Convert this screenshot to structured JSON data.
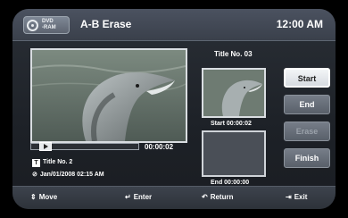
{
  "header": {
    "disc_label": "DVD\n-RAM",
    "title": "A-B Erase",
    "clock": "12:00 AM"
  },
  "preview": {
    "title_no": "Title No. 03",
    "start_label": "Start 00:00:02",
    "end_label": "End 00:00:00"
  },
  "playback": {
    "time": "00:00:02",
    "progress_fraction": 0.08
  },
  "info": {
    "title_badge": "T",
    "title": "Title No. 2",
    "date": "Jan/01/2008  02:15 AM"
  },
  "buttons": {
    "start": "Start",
    "end": "End",
    "erase": "Erase",
    "finish": "Finish"
  },
  "footer": {
    "move": "Move",
    "enter": "Enter",
    "return": "Return",
    "exit": "Exit"
  },
  "colors": {
    "header_bg": "#4b5260",
    "panel_bg": "#1d2127",
    "active_button": "#eef1f4"
  }
}
